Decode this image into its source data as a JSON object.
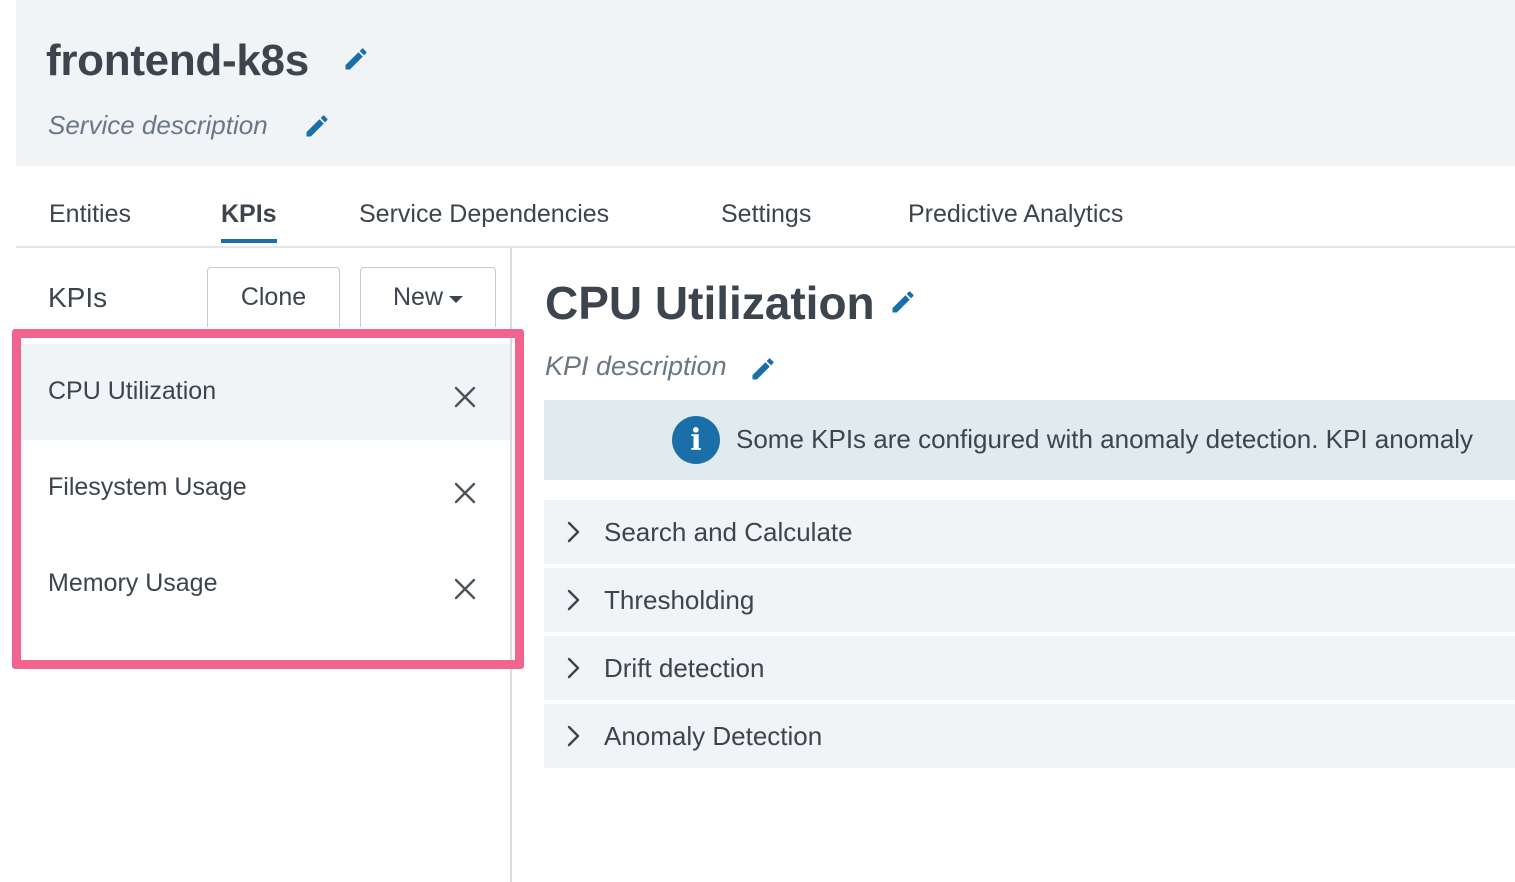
{
  "service": {
    "title": "frontend-k8s",
    "description": "Service description"
  },
  "tabs": [
    {
      "label": "Entities"
    },
    {
      "label": "KPIs"
    },
    {
      "label": "Service Dependencies"
    },
    {
      "label": "Settings"
    },
    {
      "label": "Predictive Analytics"
    }
  ],
  "kpi_panel": {
    "heading": "KPIs",
    "clone_label": "Clone",
    "new_label": "New",
    "items": [
      {
        "name": "CPU Utilization",
        "selected": true
      },
      {
        "name": "Filesystem Usage",
        "selected": false
      },
      {
        "name": "Memory Usage",
        "selected": false
      }
    ]
  },
  "kpi_detail": {
    "title": "CPU Utilization",
    "description": "KPI description",
    "info_text": "Some KPIs are configured with anomaly detection. KPI anomaly",
    "sections": [
      {
        "label": "Search and Calculate"
      },
      {
        "label": "Thresholding"
      },
      {
        "label": "Drift detection"
      },
      {
        "label": "Anomaly Detection"
      }
    ]
  },
  "colors": {
    "accent": "#1a6fa8",
    "highlight": "#f0648f",
    "header_bg": "#f1f4f6"
  }
}
